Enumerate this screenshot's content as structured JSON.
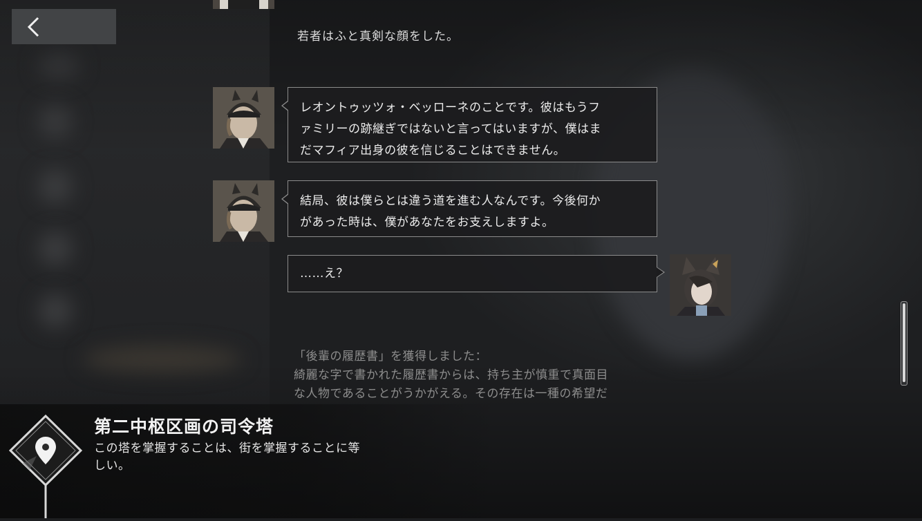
{
  "header": {
    "back_icon": "chevron-left-icon"
  },
  "dialogue": {
    "narration": "若者はふと真剣な顔をした。",
    "messages": [
      {
        "speaker_side": "left",
        "avatar": "young-man-avatar",
        "lines": [
          "レオントゥッツォ・ベッローネのことです。彼はもうフ",
          "ァミリーの跡継ぎではないと言ってはいますが、僕はま",
          "だマフィア出身の彼を信じることはできません。"
        ]
      },
      {
        "speaker_side": "left",
        "avatar": "young-man-avatar",
        "lines": [
          "結局、彼は僕らとは違う道を進む人なんです。今後何か",
          "があった時は、僕があなたをお支えしますよ。"
        ]
      },
      {
        "speaker_side": "right",
        "avatar": "player-avatar",
        "lines": [
          "……え？"
        ]
      }
    ],
    "item_message": {
      "lines": [
        "「後輩の履歴書」を獲得しました：",
        "綺麗な字で書かれた履歴書からは、持ち主が慎重で真面目",
        "な人物であることがうかがえる。その存在は一種の希望だ"
      ]
    }
  },
  "location": {
    "icon": "location-pin-icon",
    "title": "第二中枢区画の司令塔",
    "description_lines": [
      "この塔を掌握することは、街を掌握することに等",
      "しい。"
    ]
  },
  "colors": {
    "bubble_border": "#8c8c8c",
    "bubble_bg": "#1c1c1e",
    "item_text": "#8d8d8d"
  }
}
